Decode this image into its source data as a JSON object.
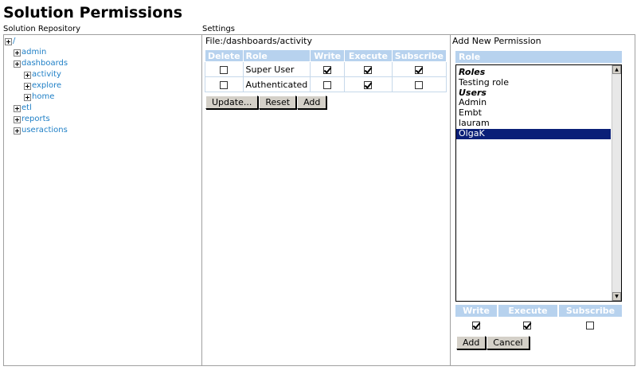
{
  "page": {
    "title": "Solution Permissions"
  },
  "panes": {
    "repository_label": "Solution Repository",
    "settings_label": "Settings",
    "add_label": "Add New Permission"
  },
  "tree": {
    "root": "/",
    "items": [
      {
        "label": "admin"
      },
      {
        "label": "dashboards"
      },
      {
        "label": "activity"
      },
      {
        "label": "explore"
      },
      {
        "label": "home"
      },
      {
        "label": "etl"
      },
      {
        "label": "reports"
      },
      {
        "label": "useractions"
      }
    ]
  },
  "settings": {
    "file_label": "File:/dashboards/activity",
    "columns": [
      "Delete",
      "Role",
      "Write",
      "Execute",
      "Subscribe"
    ],
    "rows": [
      {
        "role": "Super User",
        "delete": false,
        "write": true,
        "execute": true,
        "subscribe": true
      },
      {
        "role": "Authenticated",
        "delete": false,
        "write": false,
        "execute": true,
        "subscribe": false
      }
    ],
    "buttons": {
      "update": "Update...",
      "reset": "Reset",
      "add": "Add"
    }
  },
  "add_permission": {
    "role_header": "Role",
    "list": [
      {
        "label": "Roles",
        "kind": "group"
      },
      {
        "label": "Testing role",
        "kind": "item"
      },
      {
        "label": "Users",
        "kind": "group"
      },
      {
        "label": "Admin",
        "kind": "item"
      },
      {
        "label": "Embt",
        "kind": "item"
      },
      {
        "label": "lauram",
        "kind": "item"
      },
      {
        "label": "OlgaK",
        "kind": "item",
        "selected": true
      }
    ],
    "perm_columns": [
      "Write",
      "Execute",
      "Subscribe"
    ],
    "perm_values": {
      "write": true,
      "execute": true,
      "subscribe": false
    },
    "buttons": {
      "add": "Add",
      "cancel": "Cancel"
    },
    "selection_color": "#0a1f78"
  },
  "colors": {
    "header_blue": "#b7d2ee",
    "link": "#1e7fc6",
    "border": "#a0a0a0"
  }
}
